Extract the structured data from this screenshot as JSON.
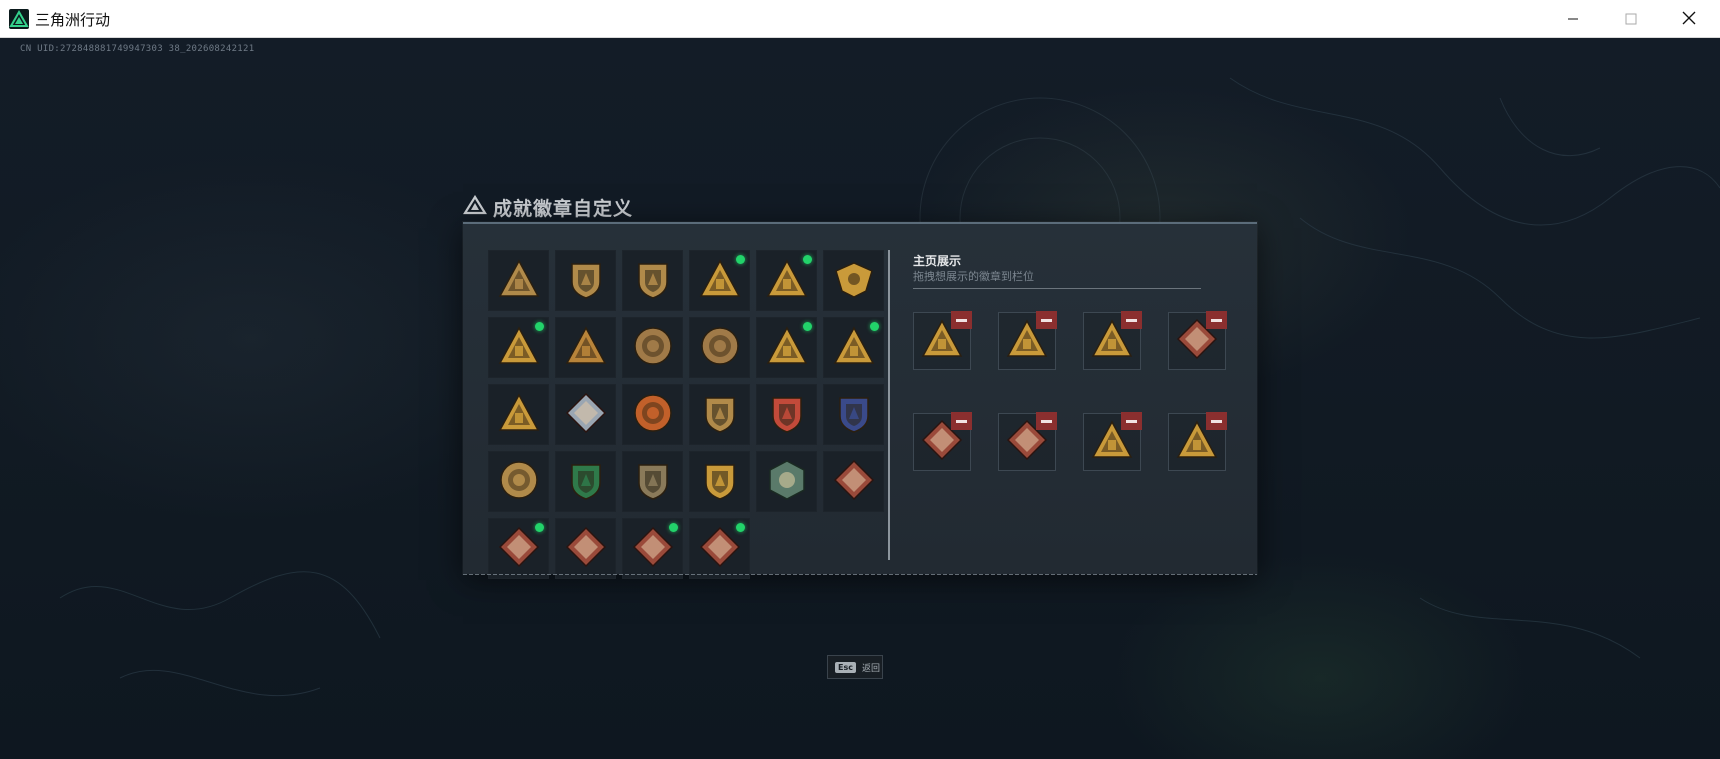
{
  "window": {
    "title": "三角洲行动",
    "controls": [
      "minimize-icon",
      "maximize-icon",
      "close-icon"
    ]
  },
  "session": {
    "uid_text": "CN UID:272848881749947303 38_202608242121"
  },
  "dialog": {
    "title": "成就徽章自定义",
    "showcase": {
      "heading": "主页展示",
      "subtitle": "拖拽想展示的徽章到栏位"
    }
  },
  "badges": [
    {
      "icon": "shield-triangle-badge-icon",
      "new": false,
      "color": "#b08a4a"
    },
    {
      "icon": "helicopter-badge-icon",
      "new": false,
      "color": "#b08a4a"
    },
    {
      "icon": "arrow-shield-badge-icon",
      "new": false,
      "color": "#b08a4a"
    },
    {
      "icon": "triangle-medal-badge-icon",
      "new": true,
      "color": "#c99a3a"
    },
    {
      "icon": "fortress-badge-icon",
      "new": true,
      "color": "#c99a3a"
    },
    {
      "icon": "eagle-crest-badge-icon",
      "new": false,
      "color": "#c99a3a"
    },
    {
      "icon": "dome-triangle-badge-icon",
      "new": true,
      "color": "#c99a3a"
    },
    {
      "icon": "number-one-badge-icon",
      "new": false,
      "color": "#b8843a"
    },
    {
      "icon": "round-emblem-badge-icon",
      "new": false,
      "color": "#a07a48"
    },
    {
      "icon": "round-crest-badge-icon",
      "new": false,
      "color": "#a07a48"
    },
    {
      "icon": "building-triangle-badge-icon",
      "new": true,
      "color": "#c99a3a"
    },
    {
      "icon": "soldier-triangle-badge-icon",
      "new": true,
      "color": "#c99a3a"
    },
    {
      "icon": "stag-triangle-badge-icon",
      "new": false,
      "color": "#c99a3a"
    },
    {
      "icon": "crystal-diamond-badge-icon",
      "new": false,
      "color": "#9aa6b2"
    },
    {
      "icon": "star-compass-badge-icon",
      "new": false,
      "color": "#c2602a"
    },
    {
      "icon": "winged-shield-badge-icon",
      "new": false,
      "color": "#b08a4a"
    },
    {
      "icon": "star-shield-badge-icon",
      "new": false,
      "color": "#c24a3a"
    },
    {
      "icon": "blue-shield-badge-icon",
      "new": false,
      "color": "#3a4a8a"
    },
    {
      "icon": "lion-medallion-badge-icon",
      "new": false,
      "color": "#b08a4a"
    },
    {
      "icon": "green-shield-badge-icon",
      "new": false,
      "color": "#2f7a4a"
    },
    {
      "icon": "rifle-shield-badge-icon",
      "new": false,
      "color": "#8a7a5a"
    },
    {
      "icon": "star-banner-badge-icon",
      "new": false,
      "color": "#c99a3a"
    },
    {
      "icon": "eagle-hexagon-badge-icon",
      "new": false,
      "color": "#5a7a6a"
    },
    {
      "icon": "dragon-diamond-badge-icon",
      "new": false,
      "color": "#9a4a3a"
    },
    {
      "icon": "dragon-diamond-badge-icon",
      "new": true,
      "color": "#9a4a3a"
    },
    {
      "icon": "wolf-diamond-badge-icon",
      "new": false,
      "color": "#9a4a3a"
    },
    {
      "icon": "serpent-diamond-badge-icon",
      "new": true,
      "color": "#9a4a3a"
    },
    {
      "icon": "wheel-diamond-badge-icon",
      "new": true,
      "color": "#9a4a3a"
    }
  ],
  "showcase_slots": [
    {
      "icon": "building-triangle-badge-icon",
      "color": "#c99a3a"
    },
    {
      "icon": "dome-triangle-badge-icon",
      "color": "#c99a3a"
    },
    {
      "icon": "soldier-triangle-badge-icon",
      "color": "#c99a3a"
    },
    {
      "icon": "dragon-diamond-badge-icon",
      "color": "#9a4a3a"
    },
    {
      "icon": "serpent-diamond-badge-icon",
      "color": "#9a4a3a"
    },
    {
      "icon": "wheel-diamond-badge-icon",
      "color": "#9a4a3a"
    },
    {
      "icon": "fortress-badge-icon",
      "color": "#c99a3a"
    },
    {
      "icon": "triangle-medal-badge-icon",
      "color": "#c99a3a"
    }
  ],
  "footer": {
    "esc_key": "Esc",
    "esc_label": "返回"
  },
  "colors": {
    "accent_green": "#22d36a",
    "remove_red": "#8b2f2f",
    "panel": "#242c34"
  }
}
